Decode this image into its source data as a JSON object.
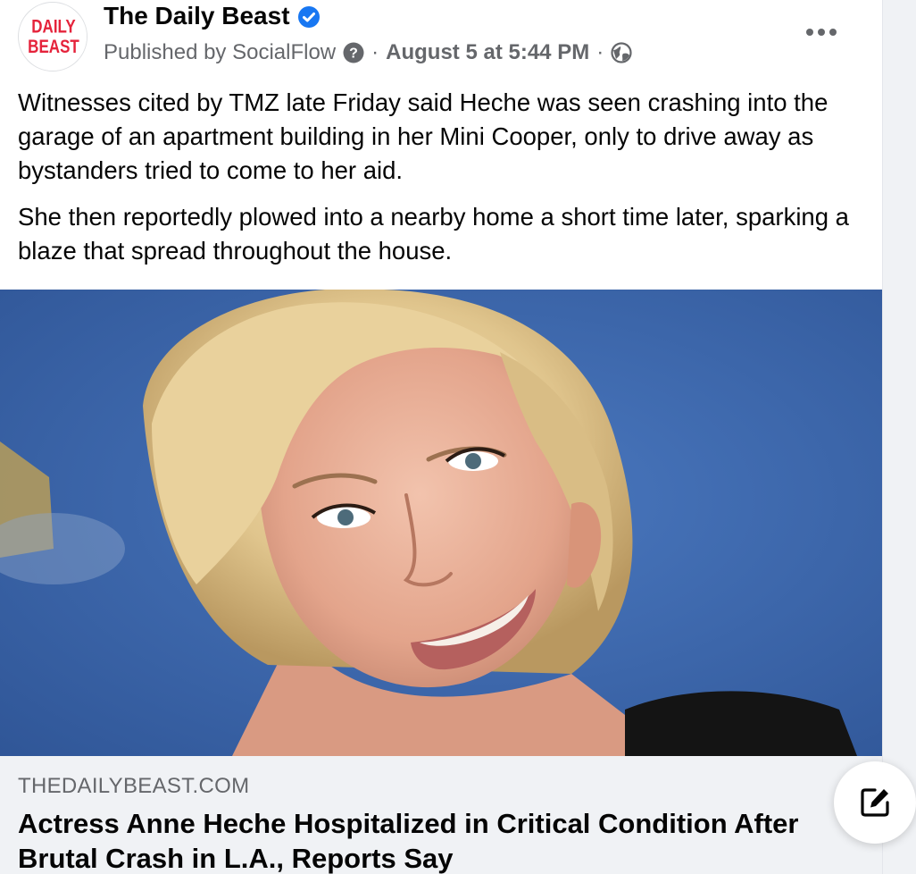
{
  "post": {
    "avatar_logo_text": [
      "DAILY",
      "BEAST"
    ],
    "page_name": "The Daily Beast",
    "verified_icon": "verified-badge-icon",
    "published_by": "Published by SocialFlow",
    "separator": "·",
    "date": "August 5 at 5:44 PM",
    "audience_icon": "globe-icon",
    "paragraphs": [
      "Witnesses cited by TMZ late Friday said Heche was seen crashing into the garage of an apartment building in her Mini Cooper, only to drive away as bystanders tried to come to her aid.",
      "She then reportedly plowed into a nearby home a short time later, sparking a blaze that spread throughout the house."
    ]
  },
  "link_preview": {
    "domain": "THEDAILYBEAST.COM",
    "title": "Actress Anne Heche Hospitalized in Critical Condition After Brutal Crash in L.A., Reports Say"
  },
  "colors": {
    "brand_red": "#e5233b",
    "verified_blue": "#1877f2",
    "meta_gray": "#65676b",
    "photo_background_blue": "#3d65a8"
  }
}
